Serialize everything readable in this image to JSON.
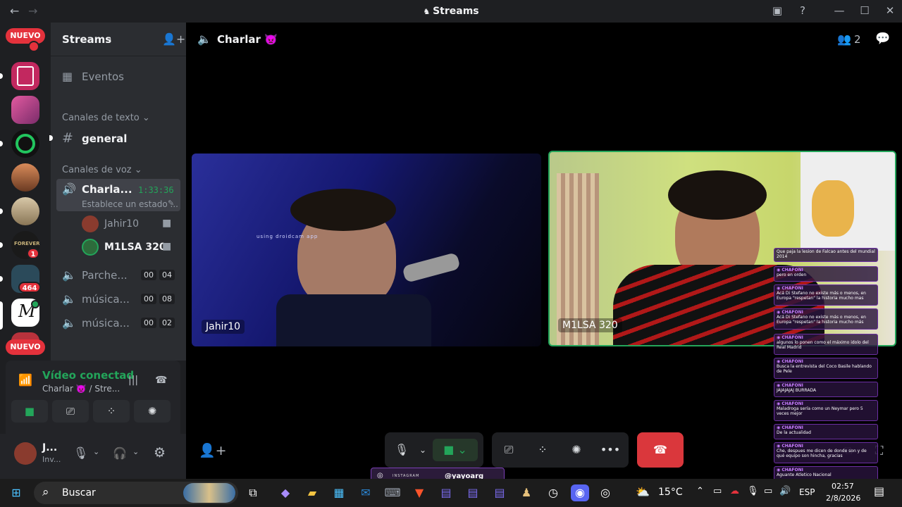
{
  "window": {
    "title": "Streams",
    "back": "←",
    "forward": "→"
  },
  "rail": {
    "nuevo_top": "NUEVO",
    "nuevo_bottom": "NUEVO",
    "badges": [
      "1",
      "464"
    ],
    "servers": [
      {
        "name": "server-1",
        "color": "#c2285f"
      },
      {
        "name": "server-2",
        "color": "#b43c8c"
      },
      {
        "name": "server-3",
        "color": "#0b6b2b"
      },
      {
        "name": "server-4",
        "color": "#8a4a2a"
      },
      {
        "name": "server-5",
        "color": "#9a8a70"
      },
      {
        "name": "server-6",
        "color": "#222222"
      },
      {
        "name": "server-7",
        "color": "#2b4a5a"
      },
      {
        "name": "server-8",
        "color": "#ffffff"
      }
    ]
  },
  "sidebar": {
    "server_name": "Streams",
    "events": "Eventos",
    "text_category": "Canales de texto",
    "general": "general",
    "voice_category": "Canales de voz",
    "active_channel": {
      "name": "Charla...",
      "time": "1:33:36",
      "status": "Establece un estado ..."
    },
    "users": [
      {
        "name": "Jahir10",
        "color": "#8a3b2e"
      },
      {
        "name": "M1LSA 320",
        "color": "#2d6b3b"
      }
    ],
    "channels": [
      {
        "name": "Parche...",
        "a": "00",
        "b": "04"
      },
      {
        "name": "música...",
        "a": "00",
        "b": "08"
      },
      {
        "name": "música...",
        "a": "00",
        "b": "02"
      }
    ]
  },
  "voice_panel": {
    "status": "Vídeo conectad",
    "sub": "Charlar 👿 / Stre..."
  },
  "user_area": {
    "name": "J...",
    "status": "Inv..."
  },
  "main": {
    "channel_title": "Charlar 👿",
    "participants": "2",
    "tiles": [
      {
        "name": "Jahir10",
        "overlay": "using droidcam app"
      },
      {
        "name": "M1LSA 320"
      }
    ]
  },
  "chat": [
    {
      "user": "",
      "text": "Que paja la lesion de Falcao antes del mundial 2014"
    },
    {
      "user": "CHAFONI",
      "text": "pero en orden"
    },
    {
      "user": "CHAFONI",
      "text": "Acá Di Stefano no existe más o menos, en Europa \"respetan\" la historia mucho mas"
    },
    {
      "user": "CHAFONI",
      "text": "Acá Di Stefano no existe más o menos, en Europa \"respetan\" la historia mucho más"
    },
    {
      "user": "CHAFONI",
      "text": "algunos lo ponen como el máximo idolo del Real Madrid"
    },
    {
      "user": "CHAFONI",
      "text": "Busca la entrevista del Coco Basile hablando de Pele"
    },
    {
      "user": "CHAFONI",
      "text": "JAJAJAJAJ BURRADA"
    },
    {
      "user": "CHAFONI",
      "text": "Maladroga sería como un Neymar pero 5 veces mejor"
    },
    {
      "user": "CHAFONI",
      "text": "De la actualidad"
    },
    {
      "user": "CHAFONI",
      "text": "Che, despues me dicen de donde son y de qué equipo son hincha, gracias"
    },
    {
      "user": "CHAFONI",
      "text": "Aguante Atletico Nacional"
    }
  ],
  "instagram": {
    "label": "INSTAGRAM",
    "handle": "@yayoarg"
  },
  "taskbar": {
    "search": "Buscar",
    "weather": "15°C",
    "lang": "ESP",
    "time": "02:57",
    "date": "2/8/2026"
  }
}
